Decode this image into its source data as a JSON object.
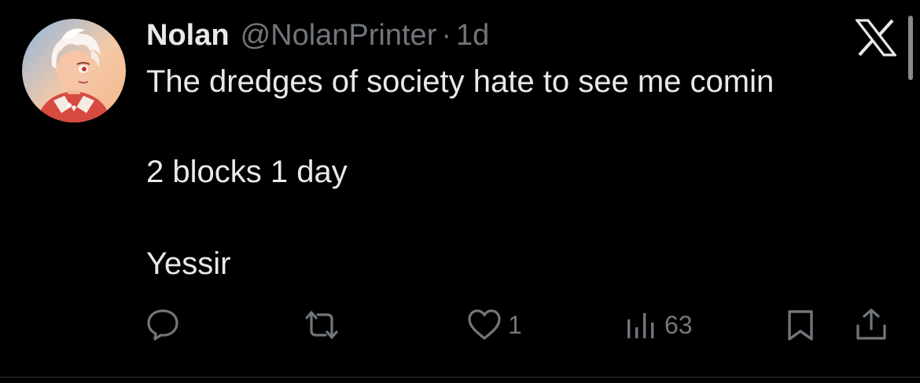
{
  "tweet": {
    "author": {
      "name": "Nolan",
      "handle": "@NolanPrinter",
      "separator": "·",
      "time": "1d"
    },
    "text": {
      "line1": "The dredges of society hate to see me comin",
      "line2": "2 blocks 1 day",
      "line3": "Yessir"
    },
    "actions": {
      "reply_icon": "speech-bubble-icon",
      "retweet_icon": "retweet-icon",
      "like_icon": "heart-icon",
      "like_count": "1",
      "views_icon": "bar-chart-icon",
      "views_count": "63",
      "bookmark_icon": "bookmark-icon",
      "share_icon": "share-icon"
    },
    "dismiss_icon": "x-logo-icon"
  },
  "colors": {
    "background": "#000000",
    "primary_text": "#e7e9ea",
    "secondary_text": "#71767b",
    "divider": "#2f3336"
  }
}
